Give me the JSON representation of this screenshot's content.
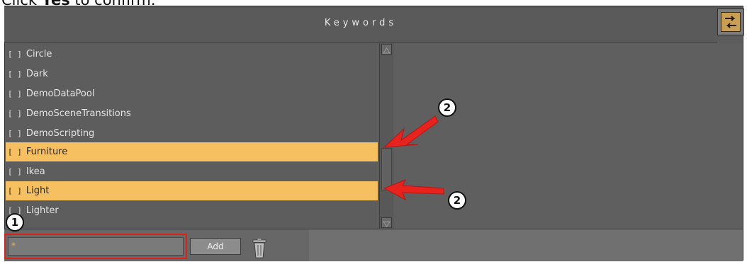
{
  "caption": {
    "prefix": "Click ",
    "bold": "Yes",
    "suffix": " to confirm."
  },
  "panel": {
    "title": "Keywords",
    "corner_icon": "swap-arrows-icon"
  },
  "keywords": [
    {
      "checkbox": "[ ]",
      "label": "Circle",
      "selected": false
    },
    {
      "checkbox": "[ ]",
      "label": "Dark",
      "selected": false
    },
    {
      "checkbox": "[ ]",
      "label": "DemoDataPool",
      "selected": false
    },
    {
      "checkbox": "[ ]",
      "label": "DemoSceneTransitions",
      "selected": false
    },
    {
      "checkbox": "[ ]",
      "label": "DemoScripting",
      "selected": false
    },
    {
      "checkbox": "[ ]",
      "label": "Furniture",
      "selected": true
    },
    {
      "checkbox": "[ ]",
      "label": "Ikea",
      "selected": false
    },
    {
      "checkbox": "[ ]",
      "label": "Light",
      "selected": true
    },
    {
      "checkbox": "[ ]",
      "label": "Lighter",
      "selected": false
    }
  ],
  "footer": {
    "input_value": "*",
    "add_label": "Add",
    "delete_icon": "trash-icon"
  },
  "callouts": {
    "one": "1",
    "two_a": "2",
    "two_b": "2"
  },
  "colors": {
    "selected_row": "#f6bf5f",
    "highlight_box": "#e0211b",
    "arrow": "#e8231e"
  }
}
